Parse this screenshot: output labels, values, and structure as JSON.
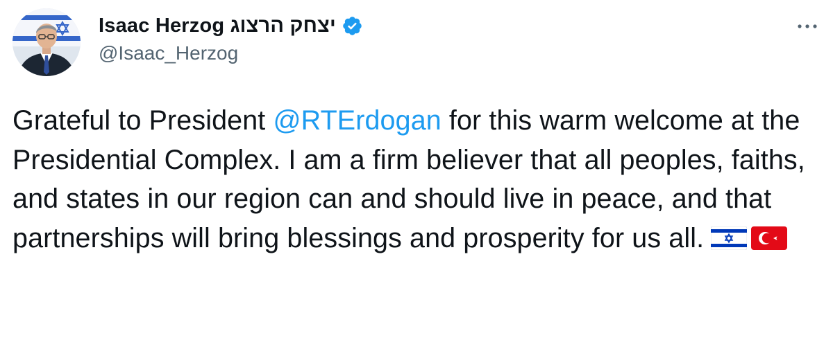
{
  "author": {
    "display_name": "Isaac Herzog יצחק הרצוג",
    "handle": "@Isaac_Herzog",
    "verified_icon": "verified-badge-icon",
    "verified_color": "#1d9bf0"
  },
  "more_icon": "more-horizontal-icon",
  "tweet": {
    "text_before_mention": "Grateful to President ",
    "mention": "@RTErdogan",
    "text_after_mention": " for this warm welcome at the Presidential Complex. I am a firm believer that all peoples, faiths, and states in our region can and should live in peace, and that partnerships will bring blessings and prosperity for us all.",
    "emojis": [
      "israel-flag-icon",
      "turkey-flag-icon"
    ]
  },
  "colors": {
    "text": "#0f1419",
    "secondary": "#536471",
    "link": "#1d9bf0",
    "turkey_red": "#e30a17",
    "israel_blue": "#0038b8"
  }
}
